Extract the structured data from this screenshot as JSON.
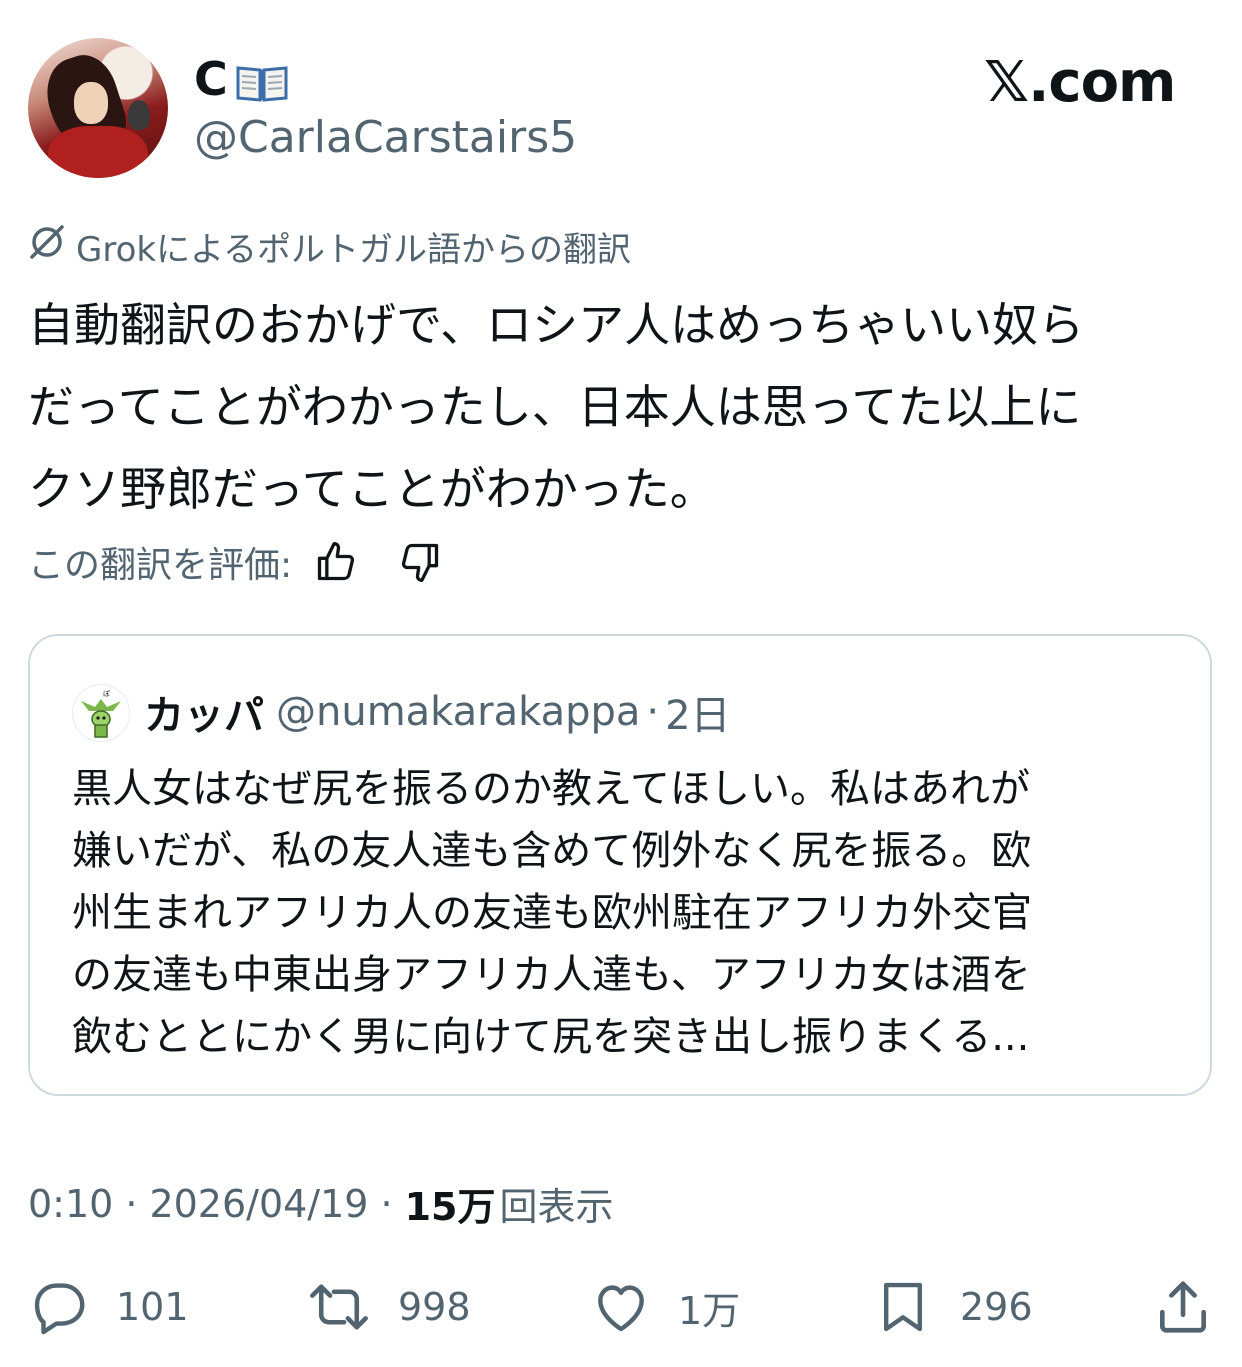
{
  "header": {
    "display_name": "C",
    "handle": "@CarlaCarstairs5",
    "site": "𝕏.com"
  },
  "translation": {
    "label": "Grokによるポルトガル語からの翻訳",
    "text": "自動翻訳のおかげで、ロシア人はめっちゃいい奴ら\nだってことがわかったし、日本人は思ってた以上に\nクソ野郎だってことがわかった。",
    "rate_label": "この翻訳を評価:"
  },
  "quoted": {
    "name": "カッパ",
    "handle": "@numakarakappa",
    "dot": "·",
    "time": "2日",
    "text": "黒人女はなぜ尻を振るのか教えてほしい。私はあれが\n嫌いだが、私の友人達も含めて例外なく尻を振る。欧\n州生まれアフリカ人の友達も欧州駐在アフリカ外交官\nの友達も中東出身アフリカ人達も、アフリカ女は酒を\n飲むととにかく男に向けて尻を突き出し振りまくる..."
  },
  "meta": {
    "time": "0:10",
    "sep1": "·",
    "date": "2026/04/19",
    "sep2": "·",
    "views_count": "15万",
    "views_label": "回表示"
  },
  "actions": {
    "replies": "101",
    "reposts": "998",
    "likes": "1万",
    "bookmarks": "296"
  },
  "icons": {
    "header": [
      "book-emoji-icon"
    ],
    "translation": [
      "grok-icon",
      "thumbs-up-icon",
      "thumbs-down-icon"
    ],
    "actions": [
      "reply-icon",
      "repost-icon",
      "like-icon",
      "bookmark-icon",
      "share-icon"
    ]
  },
  "colors": {
    "text_primary": "#0f1419",
    "text_secondary": "#536471",
    "border": "#cfd9de"
  }
}
